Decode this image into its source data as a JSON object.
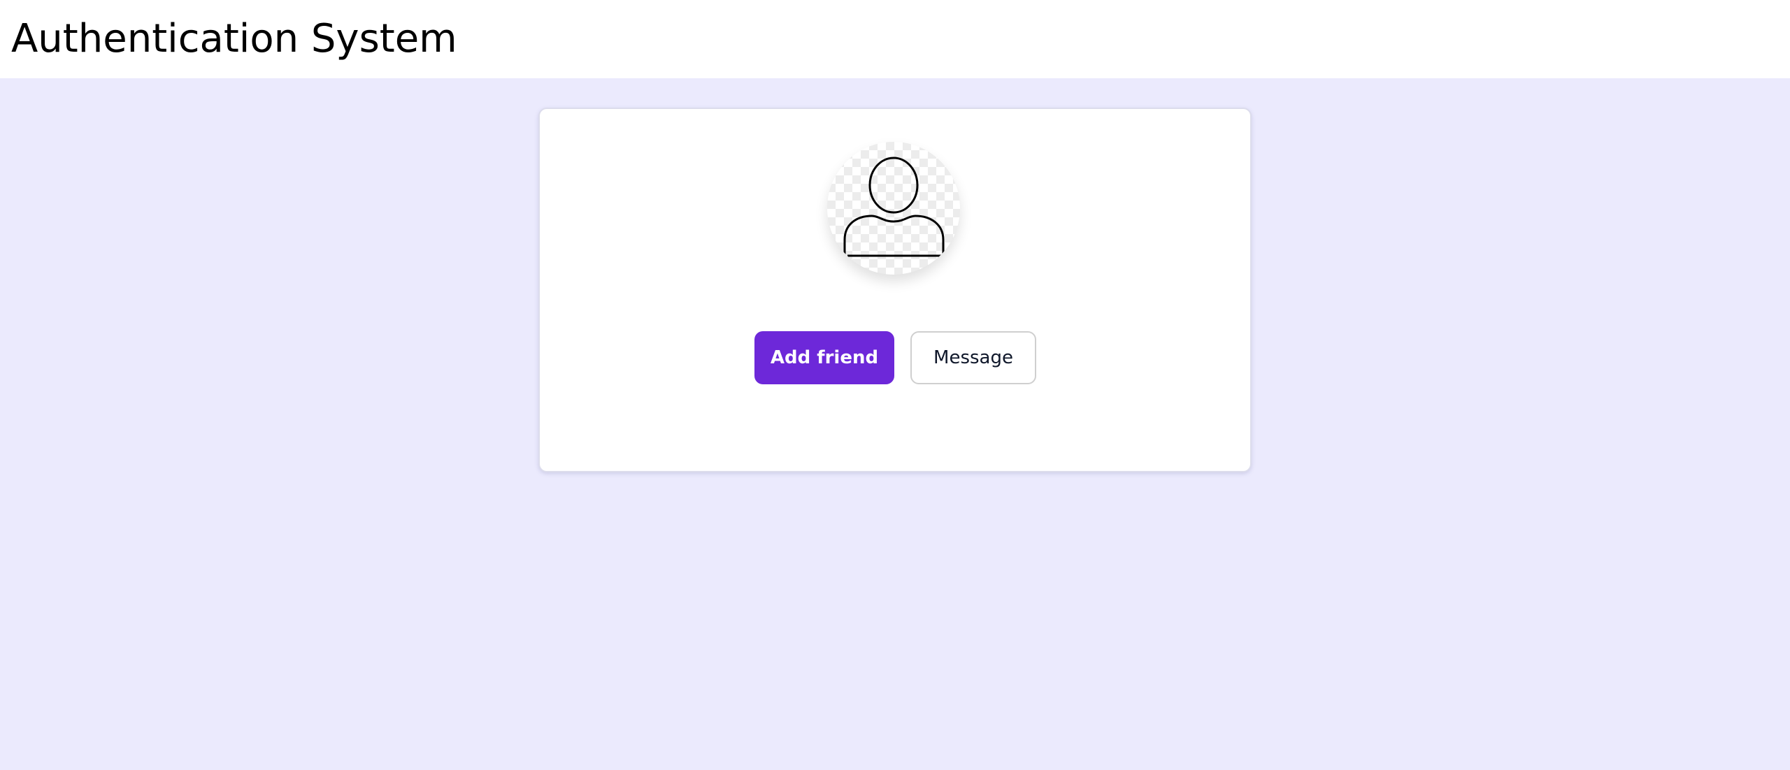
{
  "header": {
    "title": "Authentication System"
  },
  "profile_card": {
    "avatar_icon": "user-placeholder-icon",
    "primary_button_label": "Add friend",
    "secondary_button_label": "Message"
  },
  "colors": {
    "page_background": "#ebeafd",
    "primary_accent": "#6d28d9",
    "card_background": "#ffffff"
  }
}
